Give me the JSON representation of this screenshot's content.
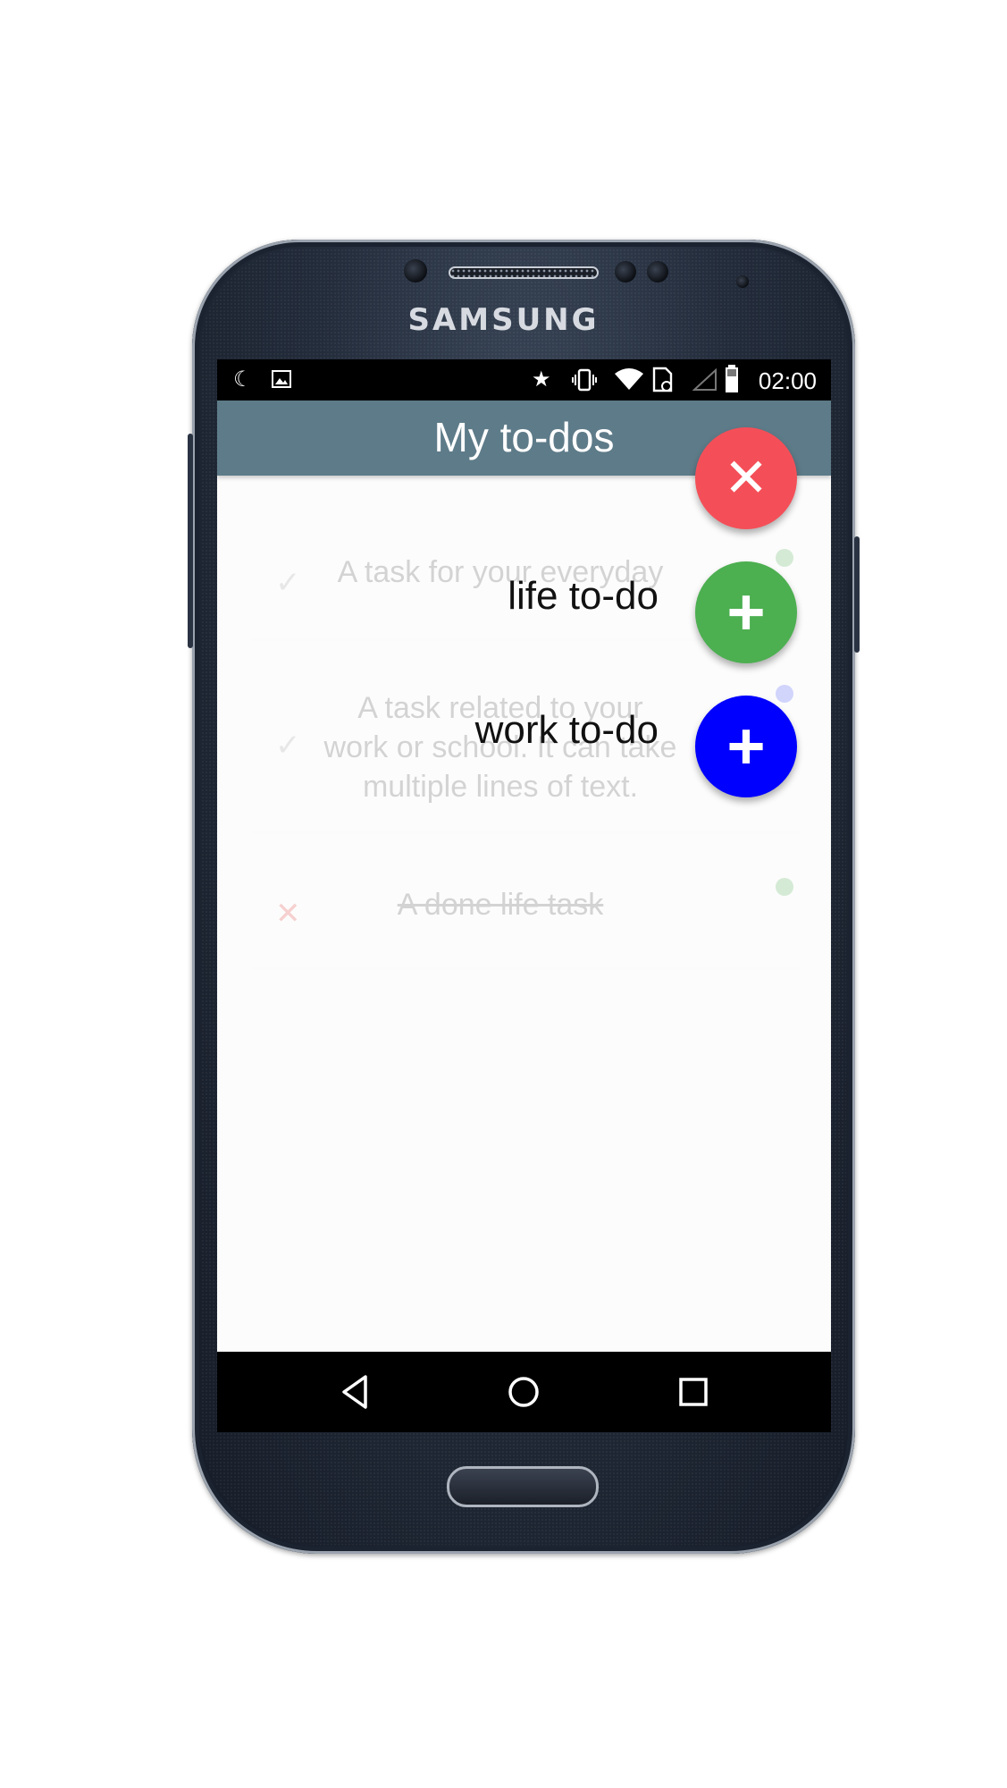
{
  "device": {
    "brand": "SAMSUNG"
  },
  "status_bar": {
    "time": "02:00",
    "left_icons": [
      "moon-icon",
      "image-icon"
    ],
    "right_icons": [
      "star-icon",
      "vibrate-icon",
      "wifi-icon",
      "sim-icon",
      "signal-icon",
      "battery-icon"
    ]
  },
  "app_bar": {
    "title": "My to-dos"
  },
  "tasks": [
    {
      "text": "A task for your everyday",
      "status": "check",
      "category": "life",
      "dot_color": "#4caf50"
    },
    {
      "text": "A task related to your work or school. It can take multiple lines of text.",
      "status": "check",
      "category": "work",
      "dot_color": "#3f51ff"
    },
    {
      "text": "A done life task",
      "status": "done",
      "category": "life",
      "dot_color": "#4caf50"
    }
  ],
  "fab_menu": {
    "close": {
      "icon": "close-icon",
      "color": "#f44f58"
    },
    "life": {
      "label": "life to-do",
      "icon": "plus-icon",
      "color": "#4caf50"
    },
    "work": {
      "label": "work to-do",
      "icon": "plus-icon",
      "color": "#0000ff"
    }
  },
  "nav_bar": {
    "icons": [
      "back-icon",
      "home-icon",
      "recents-icon"
    ]
  }
}
